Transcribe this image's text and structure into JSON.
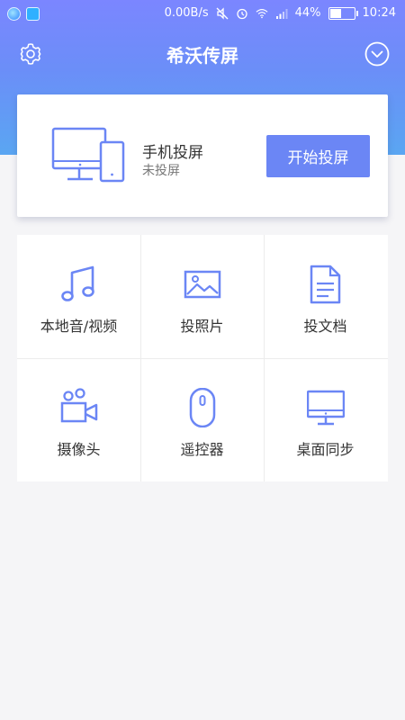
{
  "status_bar": {
    "net_speed": "0.00B/s",
    "battery_percent": "44%",
    "battery_level": 0.44,
    "time": "10:24"
  },
  "header": {
    "title": "希沃传屏",
    "settings_icon": "gear-icon",
    "menu_icon": "chevron-down-circle-icon"
  },
  "mirror_card": {
    "title": "手机投屏",
    "status": "未投屏",
    "start_label": "开始投屏",
    "icon": "devices-icon"
  },
  "features": [
    {
      "label": "本地音/视频",
      "icon": "music-note-icon"
    },
    {
      "label": "投照片",
      "icon": "image-icon"
    },
    {
      "label": "投文档",
      "icon": "document-icon"
    },
    {
      "label": "摄像头",
      "icon": "camera-icon"
    },
    {
      "label": "遥控器",
      "icon": "remote-icon"
    },
    {
      "label": "桌面同步",
      "icon": "monitor-icon"
    }
  ],
  "colors": {
    "accent": "#6b86f5",
    "header_gradient_top": "#7b86ff",
    "header_gradient_bottom": "#5aa6f2",
    "background": "#f5f5f7"
  }
}
